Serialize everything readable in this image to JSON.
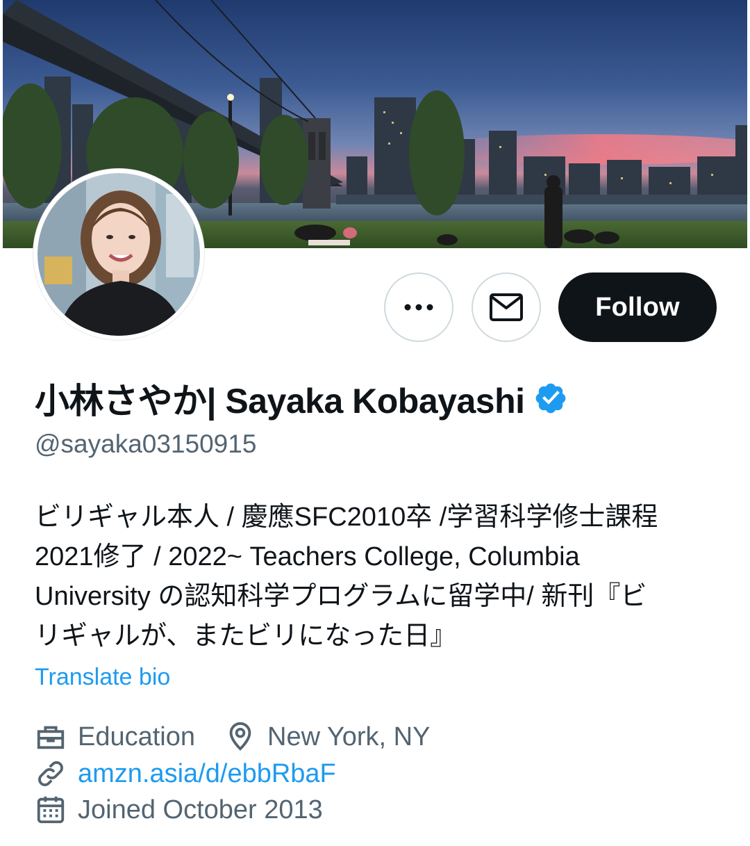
{
  "profile": {
    "display_name": "小林さやか| Sayaka Kobayashi",
    "handle": "@sayaka03150915",
    "verified": true,
    "bio_lines": [
      "ビリギャル本人 / 慶應SFC2010卒 /学習科学修士課程",
      "2021修了 / 2022~ Teachers College, Columbia",
      "University の認知科学プログラムに留学中/ 新刊『ビ",
      "リギャルが、またビリになった日』"
    ],
    "translate_label": "Translate bio",
    "category": "Education",
    "location": "New York, NY",
    "website": "amzn.asia/d/ebbRbaF",
    "joined": "Joined October 2013"
  },
  "actions": {
    "more_icon": "more-horizontal-icon",
    "message_icon": "envelope-icon",
    "follow_label": "Follow"
  },
  "icons": {
    "category": "briefcase-icon",
    "location": "map-pin-icon",
    "website": "link-icon",
    "joined": "calendar-icon"
  },
  "colors": {
    "text_primary": "#0f1419",
    "text_secondary": "#536471",
    "accent": "#1d9bf0",
    "verified": "#1d9bf0",
    "follow_bg": "#0f1419",
    "border": "#cfd9de"
  }
}
